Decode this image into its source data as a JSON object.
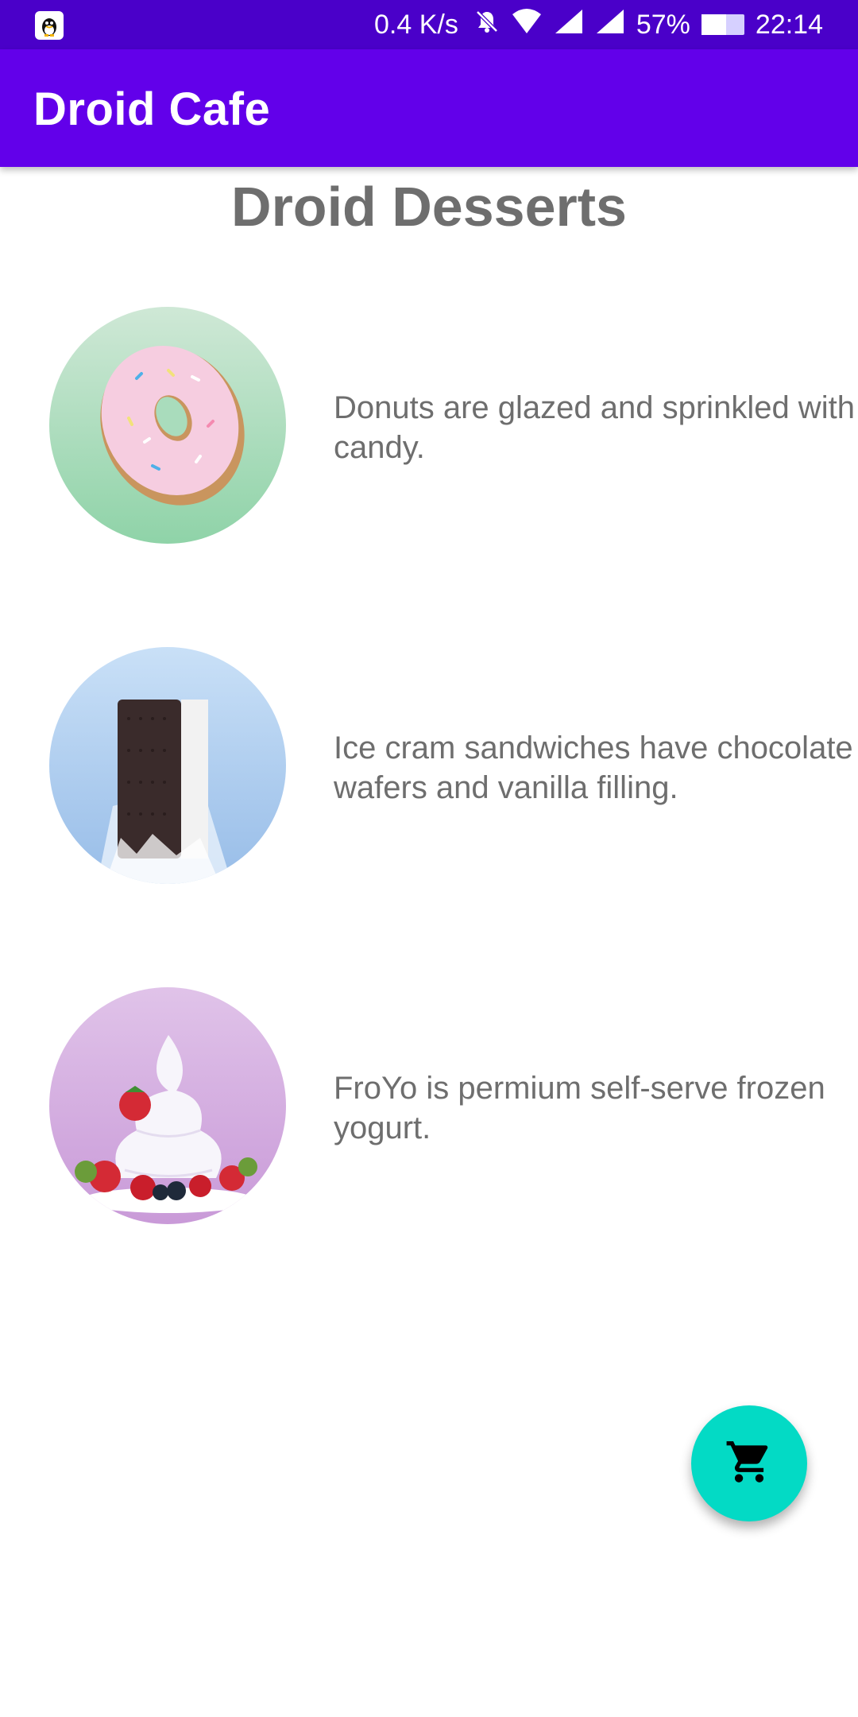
{
  "status_bar": {
    "network_speed": "0.4 K/s",
    "battery_percent": "57%",
    "battery_level": 0.57,
    "time": "22:14"
  },
  "app_bar": {
    "title": "Droid Cafe"
  },
  "page": {
    "heading": "Droid Desserts"
  },
  "desserts": [
    {
      "name": "donut",
      "description": "Donuts are glazed and sprinkled with candy.",
      "image_icon": "donut-image"
    },
    {
      "name": "ice-cream-sandwich",
      "description": "Ice cram sandwiches have chocolate wafers and vanilla filling.",
      "image_icon": "ice-cream-sandwich-image"
    },
    {
      "name": "froyo",
      "description": "FroYo is permium self-serve frozen yogurt.",
      "image_icon": "froyo-image"
    }
  ],
  "fab": {
    "icon": "shopping-cart-icon",
    "color": "#03dac5"
  },
  "colors": {
    "status_bar": "#4a00c9",
    "app_bar": "#6200ea",
    "text_secondary": "#6e6e6e"
  }
}
